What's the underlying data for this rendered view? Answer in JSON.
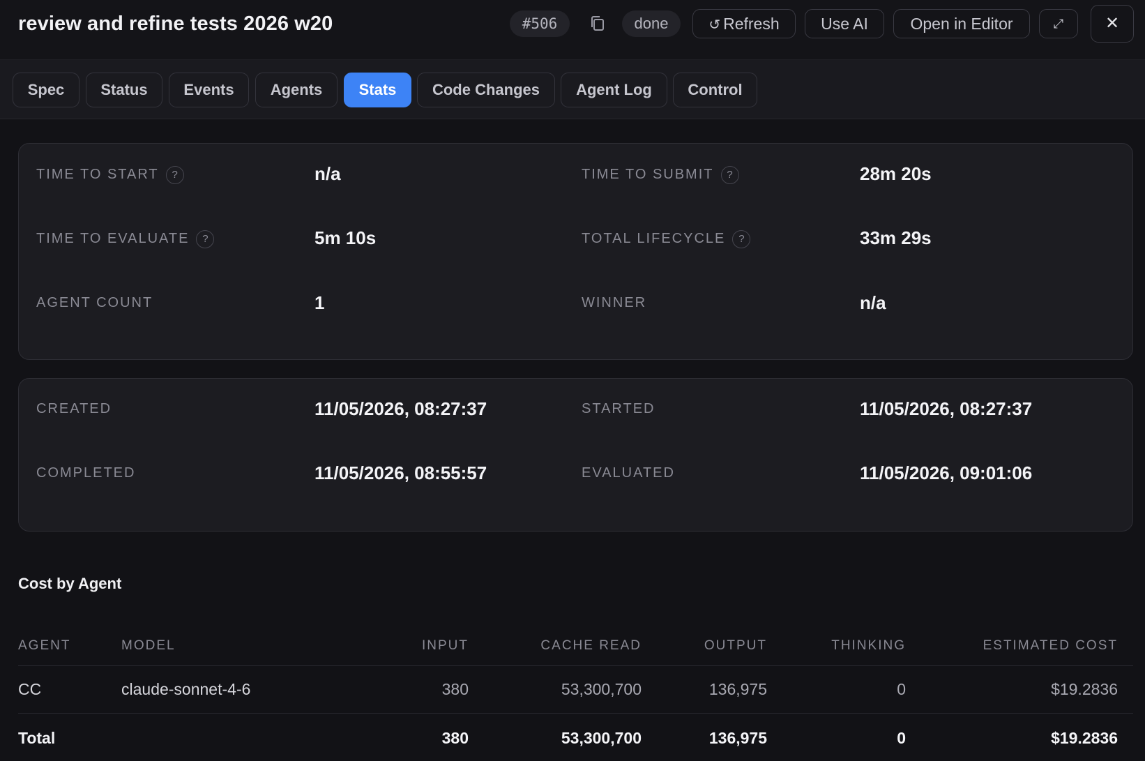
{
  "header": {
    "title": "review and refine tests 2026 w20",
    "task_id": "#506",
    "status": "done",
    "buttons": {
      "refresh_icon": "↺",
      "refresh": "Refresh",
      "use_ai": "Use AI",
      "open_in_editor": "Open in Editor",
      "expand": "⤢",
      "close": "✕"
    },
    "icons": [
      "copy-icon",
      "refresh-icon",
      "expand-icon",
      "close-icon"
    ]
  },
  "tabs": [
    {
      "label": "Spec",
      "active": false
    },
    {
      "label": "Status",
      "active": false
    },
    {
      "label": "Events",
      "active": false
    },
    {
      "label": "Agents",
      "active": false
    },
    {
      "label": "Stats",
      "active": true
    },
    {
      "label": "Code Changes",
      "active": false
    },
    {
      "label": "Agent Log",
      "active": false
    },
    {
      "label": "Control",
      "active": false
    }
  ],
  "stats": {
    "time_to_start": {
      "label": "Time to start",
      "value": "n/a"
    },
    "time_to_submit": {
      "label": "Time to submit",
      "value": "28m 20s"
    },
    "time_to_evaluate": {
      "label": "Time to evaluate",
      "value": "5m 10s"
    },
    "total_lifecycle": {
      "label": "Total lifecycle",
      "value": "33m 29s"
    },
    "agent_count": {
      "label": "Agent count",
      "value": "1"
    },
    "winner": {
      "label": "Winner",
      "value": "n/a"
    },
    "help_glyph": "?"
  },
  "timestamps": {
    "created": {
      "label": "Created",
      "value": "11/05/2026, 08:27:37"
    },
    "started": {
      "label": "Started",
      "value": "11/05/2026, 08:27:37"
    },
    "completed": {
      "label": "Completed",
      "value": "11/05/2026, 08:55:57"
    },
    "evaluated": {
      "label": "Evaluated",
      "value": "11/05/2026, 09:01:06"
    }
  },
  "cost": {
    "title": "Cost by Agent",
    "columns": [
      "AGENT",
      "MODEL",
      "INPUT",
      "CACHE READ",
      "OUTPUT",
      "THINKING",
      "ESTIMATED COST"
    ],
    "rows": [
      {
        "agent": "CC",
        "model": "claude-sonnet-4-6",
        "input": "380",
        "cache_read": "53,300,700",
        "output": "136,975",
        "thinking": "0",
        "cost": "$19.2836"
      }
    ],
    "total": {
      "label": "Total",
      "input": "380",
      "cache_read": "53,300,700",
      "output": "136,975",
      "thinking": "0",
      "cost": "$19.2836"
    }
  },
  "colors": {
    "background": "#121216",
    "card": "#1c1c21",
    "accent": "#3d83f6",
    "muted_text": "#8a8a94"
  }
}
